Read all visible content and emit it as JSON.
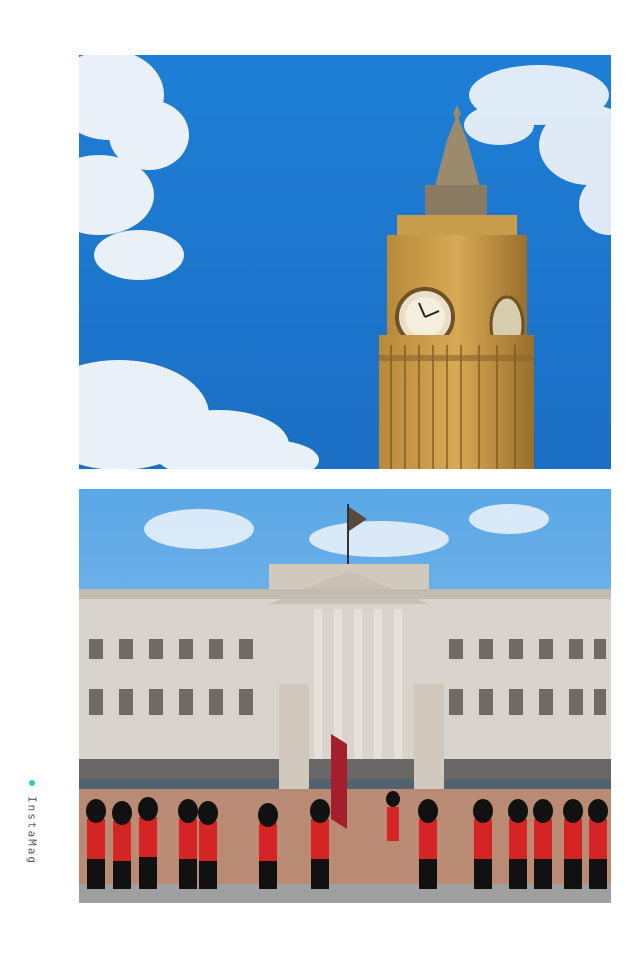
{
  "images": [
    {
      "subject": "big-ben-clock-tower",
      "sky": "#1f86d9"
    },
    {
      "subject": "buckingham-palace-guards",
      "sky": "#6bb3ea"
    }
  ],
  "watermark": {
    "text": "InstaMag",
    "accent": "#2fc7c6"
  }
}
